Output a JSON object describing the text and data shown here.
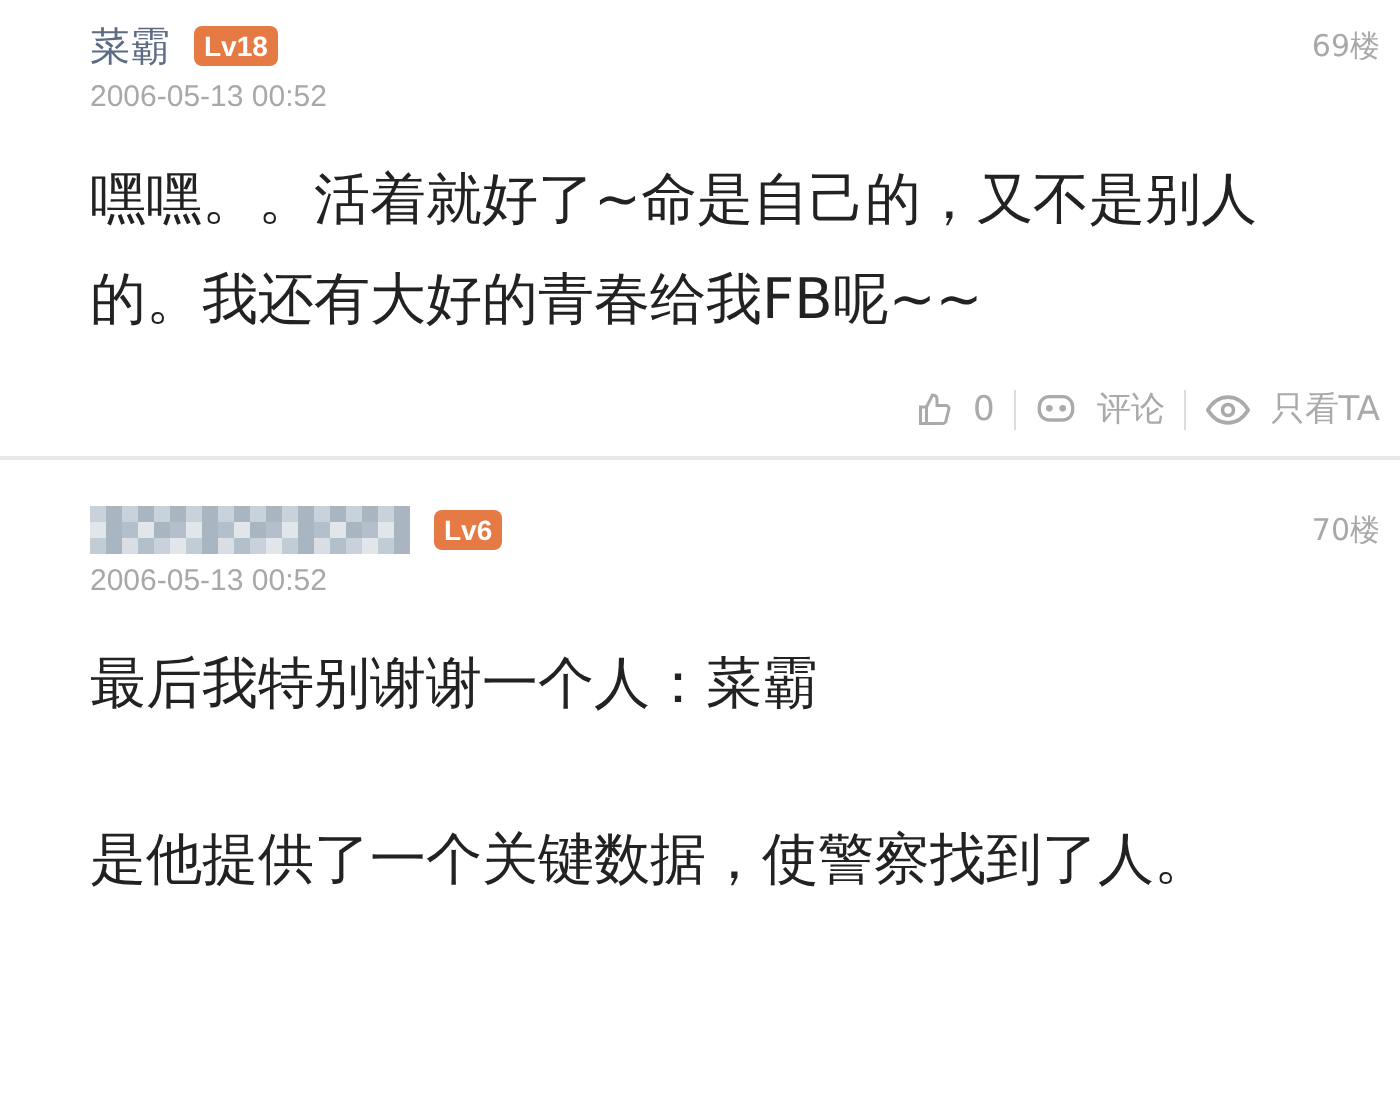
{
  "posts": [
    {
      "author": {
        "kind": "text",
        "name": "菜霸"
      },
      "level": "Lv18",
      "floor": "69楼",
      "time": "2006-05-13 00:52",
      "paragraphs": [
        "嘿嘿。。活着就好了~命是自己的，又不是别人的。我还有大好的青春给我FB呢~~"
      ],
      "actions": {
        "likes": "0",
        "comment": "评论",
        "only_ta": "只看TA"
      }
    },
    {
      "author": {
        "kind": "blurred"
      },
      "level": "Lv6",
      "floor": "70楼",
      "time": "2006-05-13 00:52",
      "paragraphs": [
        "最后我特别谢谢一个人：菜霸",
        "是他提供了一个关键数据，使警察找到了人。"
      ]
    }
  ]
}
